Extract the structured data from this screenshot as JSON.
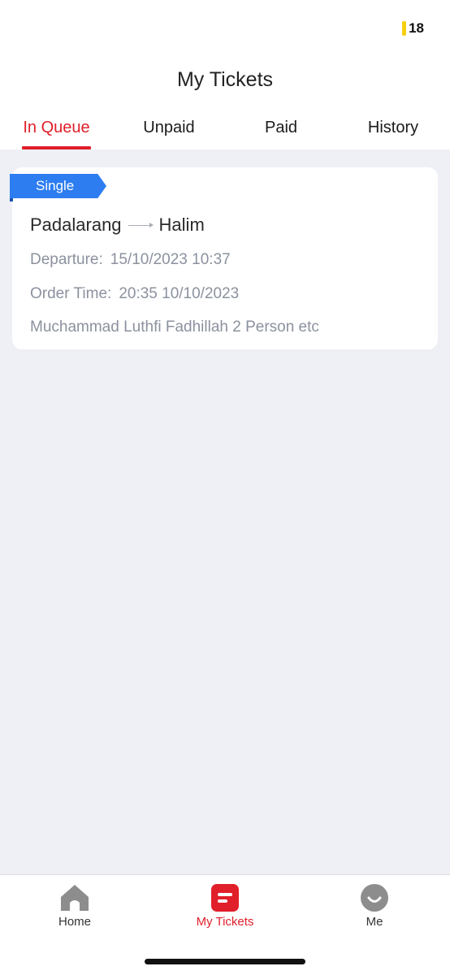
{
  "status_bar": {
    "battery": "18"
  },
  "header": {
    "title": "My Tickets"
  },
  "tabs": [
    {
      "label": "In Queue",
      "active": true
    },
    {
      "label": "Unpaid",
      "active": false
    },
    {
      "label": "Paid",
      "active": false
    },
    {
      "label": "History",
      "active": false
    }
  ],
  "ticket": {
    "type": "Single",
    "from": "Padalarang",
    "to": "Halim",
    "departure_label": "Departure:",
    "departure_value": "15/10/2023 10:37",
    "order_label": "Order Time:",
    "order_value": "20:35 10/10/2023",
    "passengers": "Muchammad Luthfi Fadhillah 2 Person etc"
  },
  "bottom_nav": [
    {
      "label": "Home",
      "icon": "home-icon",
      "active": false
    },
    {
      "label": "My Tickets",
      "icon": "tickets-icon",
      "active": true
    },
    {
      "label": "Me",
      "icon": "profile-icon",
      "active": false
    }
  ],
  "colors": {
    "accent": "#e01f2a",
    "badge": "#2d7df0",
    "background": "#eef0f5"
  }
}
